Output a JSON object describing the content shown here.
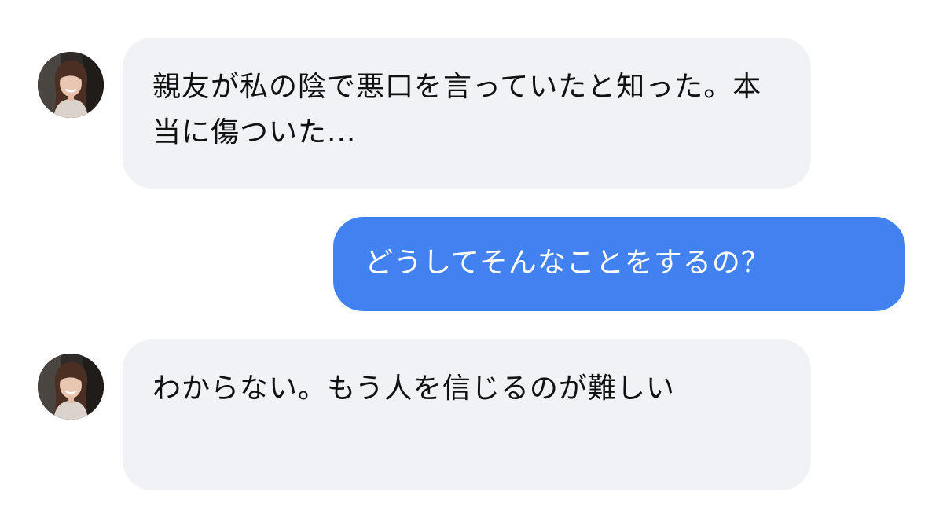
{
  "conversation": {
    "messages": [
      {
        "sender": "other",
        "text": "親友が私の陰で悪口を言っていたと知った。本当に傷ついた...",
        "avatar_icon": "user-avatar-icon"
      },
      {
        "sender": "me",
        "text": "どうしてそんなことをするの？"
      },
      {
        "sender": "other",
        "text": "わからない。もう人を信じるのが難しい",
        "avatar_icon": "user-avatar-icon"
      }
    ]
  },
  "colors": {
    "incoming_bubble": "#f1f2f6",
    "outgoing_bubble": "#4282f0",
    "incoming_text": "#111111",
    "outgoing_text": "#ffffff"
  }
}
